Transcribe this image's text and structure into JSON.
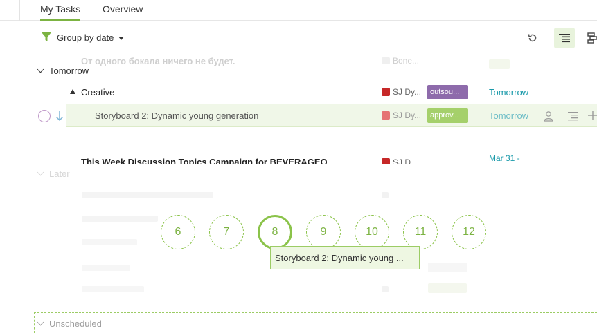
{
  "tabs": [
    {
      "label": "My Tasks",
      "active": true
    },
    {
      "label": "Overview",
      "active": false
    }
  ],
  "toolbar": {
    "group_label": "Group by date",
    "icons": [
      "undo-icon",
      "indent-list-icon",
      "gantt-icon"
    ]
  },
  "faded_row": {
    "title": "От одного бокала ничего не будет.",
    "assignee": "Bone..."
  },
  "sections": {
    "tomorrow": "Tomorrow",
    "later": "Later",
    "unscheduled": "Unscheduled"
  },
  "rows": {
    "creative": {
      "title": "Creative",
      "assignee": "SJ Dy...",
      "tag": "outsou...",
      "tag_color": "#8e6bab",
      "date": "Tomorrow"
    },
    "storyboard": {
      "title": "Storyboard 2: Dynamic young generation",
      "assignee": "SJ Dy...",
      "tag": "approv...",
      "tag_color": "#a5d06b",
      "date": "Tomorrow"
    },
    "this_week": {
      "title": "This Week Discussion Topics Campaign for BEVERAGEO",
      "assignee": "SJ D...",
      "date": "Mar 31 -"
    }
  },
  "numbers": [
    "6",
    "7",
    "8",
    "9",
    "10",
    "11",
    "12"
  ],
  "tooltip": "Storyboard 2: Dynamic young ...",
  "colors": {
    "accent": "#7cb342",
    "date": "#1a9aaa",
    "project_red": "#c62828"
  }
}
